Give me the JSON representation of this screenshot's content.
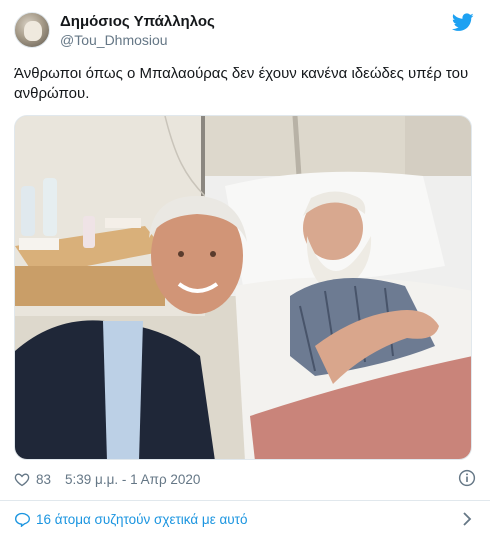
{
  "user": {
    "display_name": "Δημόσιος Υπάλληλος",
    "handle": "@Tou_Dhmosiou",
    "avatar_icon": "user-avatar",
    "verified_service_icon": "twitter-bird-icon"
  },
  "tweet": {
    "text": "Άνθρωποι όπως ο Μπαλαούρας δεν έχουν κανένα ιδεώδες υπέρ του ανθρώπου."
  },
  "meta": {
    "like_icon": "heart-icon",
    "likes": "83",
    "timestamp": "5:39 μ.μ. - 1 Απρ 2020",
    "info_icon": "info-icon"
  },
  "discussion": {
    "icon": "speech-bubble-icon",
    "label": "16 άτομα συζητούν σχετικά με αυτό",
    "chevron_icon": "chevron-right-icon"
  },
  "colors": {
    "link_blue": "#1b95e0",
    "twitter_blue": "#1da1f2",
    "meta_gray": "#657786",
    "text_dark": "#14171a"
  }
}
